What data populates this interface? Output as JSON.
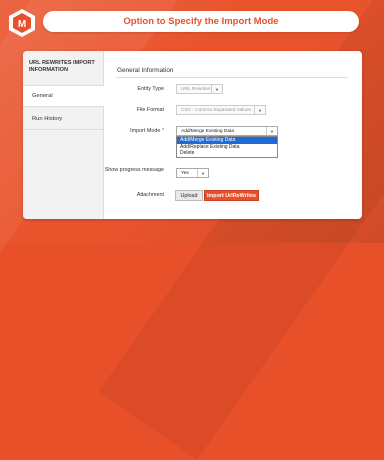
{
  "header": {
    "title": "Option to Specify the Import Mode"
  },
  "logo": {
    "icon": "me-logo-icon"
  },
  "sidebar": {
    "title": "URL REWRITES IMPORT INFORMATION",
    "tabs": [
      {
        "label": "General",
        "active": true
      },
      {
        "label": "Run History",
        "active": false
      }
    ]
  },
  "main": {
    "section_title": "General Information",
    "fields": {
      "entity_type": {
        "label": "Entity Type",
        "value": "URL Rewrites"
      },
      "file_format": {
        "label": "File Format",
        "value": "CSV - Comma Separated Values"
      },
      "import_mode": {
        "label": "Import Mode",
        "required": "*",
        "value": "Add/Merge Existing Data",
        "options": [
          "Add/Merge Existing Data",
          "Add/Replace Existing Data",
          "Delete"
        ],
        "selected_index": 0
      },
      "show_progress": {
        "label": "Show progress message",
        "value": "Yes"
      },
      "attachment": {
        "label": "Attachment"
      }
    },
    "buttons": {
      "upload": "Upload",
      "import": "Import UrlReWrites"
    }
  },
  "colors": {
    "accent": "#e8502a",
    "highlight": "#1e6bd6"
  }
}
